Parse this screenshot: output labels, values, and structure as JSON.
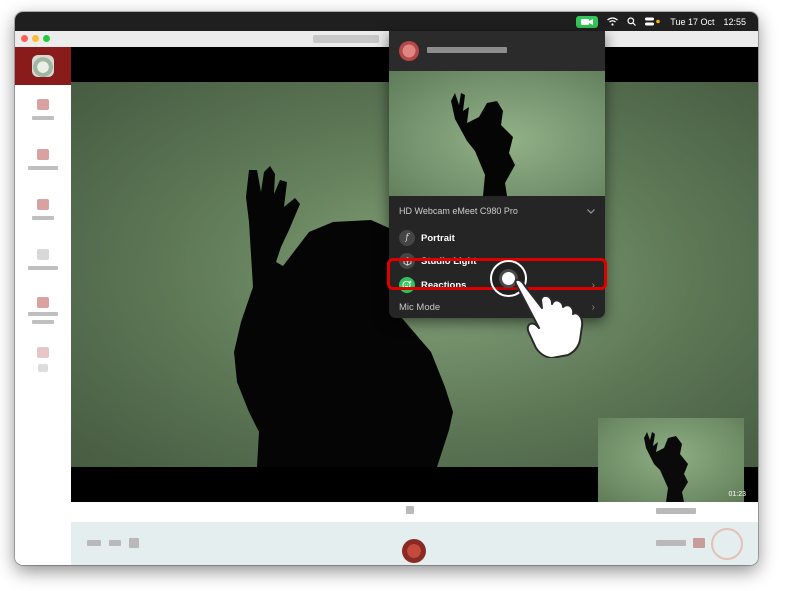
{
  "menubar": {
    "date": "Tue 17 Oct",
    "time": "12:55",
    "icons": [
      "facetime-camera-icon",
      "wifi-icon",
      "search-icon",
      "control-center-icon"
    ],
    "camera_pill_color": "#34c759"
  },
  "video": {
    "pip_timer": "01:23"
  },
  "panel": {
    "camera_name": "HD Webcam eMeet C980 Pro",
    "items": [
      {
        "label": "Portrait",
        "icon": "portrait-f-icon"
      },
      {
        "label": "Studio Light",
        "icon": "cube-icon"
      },
      {
        "label": "Reactions",
        "icon": "reactions-icon"
      }
    ],
    "mic_mode": "Mic Mode"
  },
  "colors": {
    "sidebar_top": "#8a1b1b",
    "highlight": "#e00000",
    "reactions_green": "#2fc25b"
  }
}
